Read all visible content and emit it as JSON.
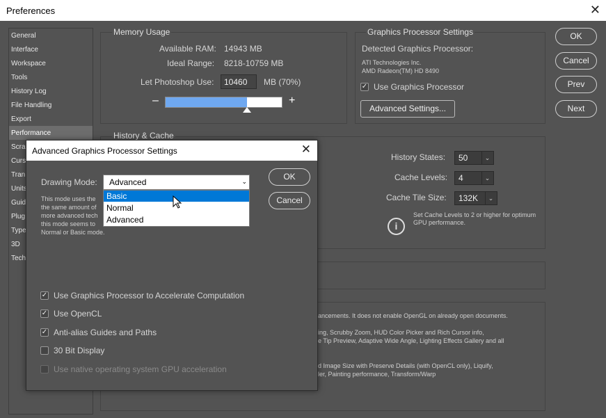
{
  "window": {
    "title": "Preferences"
  },
  "nav": [
    "General",
    "Interface",
    "Workspace",
    "Tools",
    "History Log",
    "File Handling",
    "Export",
    "Performance",
    "Scra",
    "Curs",
    "Tran",
    "Units",
    "Guid",
    "Plug",
    "Type",
    "3D",
    "Tech"
  ],
  "memory": {
    "title": "Memory Usage",
    "available_label": "Available RAM:",
    "available_value": "14943 MB",
    "ideal_label": "Ideal Range:",
    "ideal_value": "8218-10759 MB",
    "let_label": "Let Photoshop Use:",
    "let_value": "10460",
    "let_unit": "MB (70%)",
    "slider_fraction": 0.7,
    "minus": "–",
    "plus": "+"
  },
  "gpu": {
    "title": "Graphics Processor Settings",
    "detected_label": "Detected Graphics Processor:",
    "vendor": "ATI Technologies Inc.",
    "model": "AMD Radeon(TM) HD 8490",
    "use_gpu": "Use Graphics Processor",
    "advanced_button": "Advanced Settings..."
  },
  "history": {
    "title": "History & Cache",
    "states_label": "History States:",
    "states_value": "50",
    "levels_label": "Cache Levels:",
    "levels_value": "4",
    "tile_label": "Cache Tile Size:",
    "tile_value": "132K",
    "info": "Set Cache Levels to 2 or higher for optimum GPU performance."
  },
  "desc": {
    "line1": "ancements. It does not enable OpenGL on already open documents.",
    "line2": "ing, Scrubby Zoom, HUD Color Picker and Rich Cursor info,",
    "line3": "e Tip Preview, Adaptive Wide Angle, Lighting Effects Gallery and all",
    "line4": "d Image Size with Preserve Details (with OpenCL only), Liquify,",
    "line5": "ler, Painting performance, Transform/Warp"
  },
  "buttons": {
    "ok": "OK",
    "cancel": "Cancel",
    "prev": "Prev",
    "next": "Next"
  },
  "dialog": {
    "title": "Advanced Graphics Processor Settings",
    "mode_label": "Drawing Mode:",
    "mode_value": "Advanced",
    "options": [
      "Basic",
      "Normal",
      "Advanced"
    ],
    "desc1": "This mode uses the",
    "desc2": "the same amount of",
    "desc3": "more advanced tech",
    "desc4": "this mode seems to",
    "desc5": "Normal or Basic mode.",
    "ok": "OK",
    "cancel": "Cancel",
    "check1": "Use Graphics Processor to Accelerate Computation",
    "check2": "Use OpenCL",
    "check3": "Anti-alias Guides and Paths",
    "check4": "30 Bit Display",
    "check5": "Use native operating system GPU acceleration",
    "check_mark": "✓"
  }
}
